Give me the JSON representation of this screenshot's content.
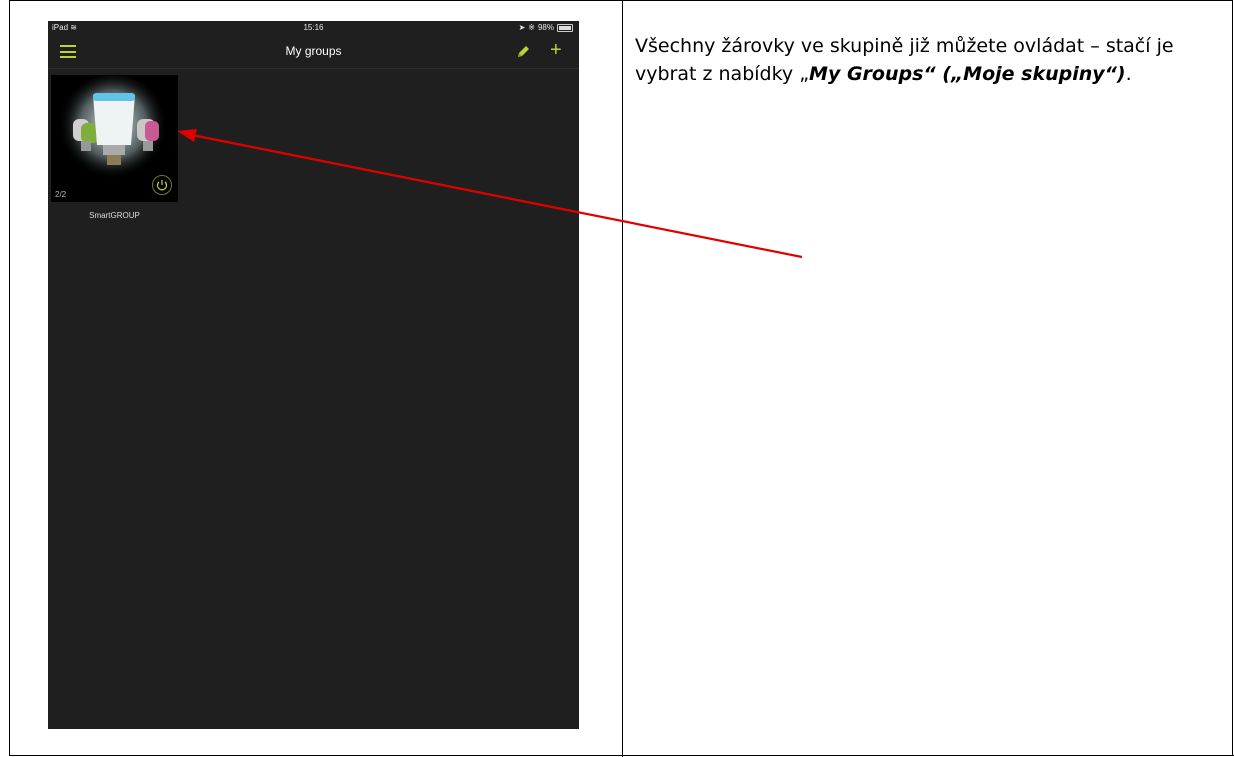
{
  "status_bar": {
    "device": "iPad",
    "time": "15:16",
    "battery": "98%",
    "battery_level": 0.98
  },
  "nav": {
    "title": "My groups",
    "menu_icon": "hamburger-menu-icon",
    "edit_icon": "pencil-icon",
    "add_icon": "plus-icon",
    "accent_color": "#b9d534"
  },
  "groups": [
    {
      "name": "SmartGROUP",
      "count": "2/2",
      "power_icon": "power-icon"
    }
  ],
  "description": {
    "text_before": "Všechny žárovky ve skupině již můžete ovládat – stačí je vybrat z nabídky „",
    "bold_italic": "My Groups“ („Moje skupiny“)",
    "text_after": "."
  },
  "arrow_color": "#e00000"
}
